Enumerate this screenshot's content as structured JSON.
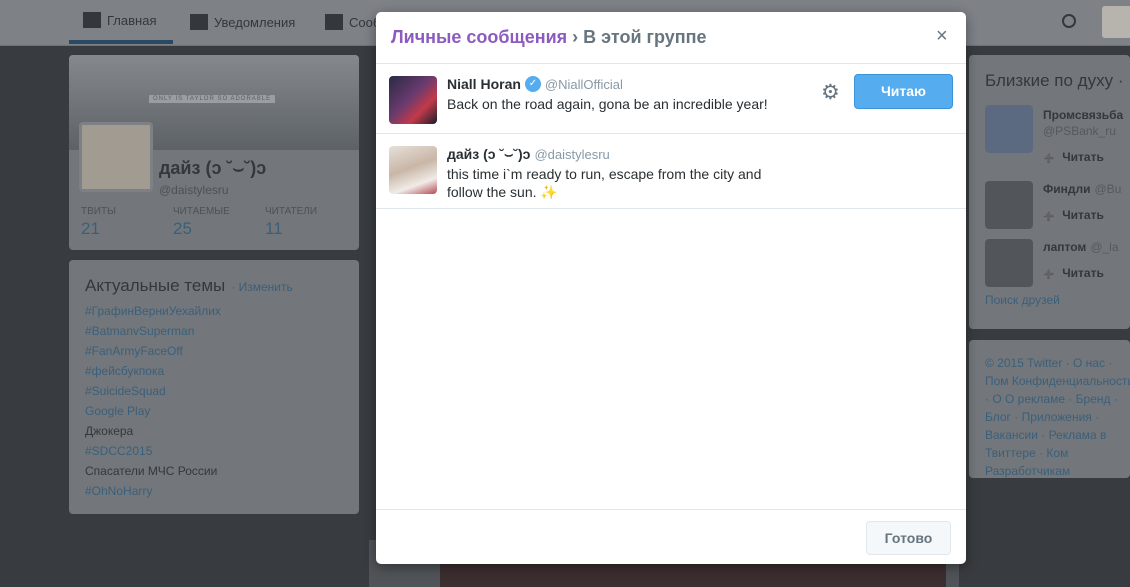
{
  "nav": {
    "home": "Главная",
    "notifications": "Уведомления",
    "messages": "Сооб"
  },
  "profile": {
    "banner_text": "ONLY IS TAYLOR SO ADORABLE",
    "name": "дайз (ɔ ˘⌣˘)ɔ",
    "handle": "@daistylesru",
    "stats": [
      {
        "label": "ТВИТЫ",
        "value": "21"
      },
      {
        "label": "ЧИТАЕМЫЕ",
        "value": "25"
      },
      {
        "label": "ЧИТАТЕЛИ",
        "value": "11"
      }
    ]
  },
  "trends": {
    "title": "Актуальные темы",
    "change": "· Изменить",
    "items": [
      {
        "text": "#ГрафинВерниУехайлих",
        "hashtag": true
      },
      {
        "text": "#BatmanvSuperman",
        "hashtag": true
      },
      {
        "text": "#FanArmyFaceOff",
        "hashtag": true
      },
      {
        "text": "#фейсбукпока",
        "hashtag": true
      },
      {
        "text": "#SuicideSquad",
        "hashtag": true
      },
      {
        "text": "Google Play",
        "hashtag": true
      },
      {
        "text": "Джокера",
        "hashtag": false
      },
      {
        "text": "#SDCC2015",
        "hashtag": true
      },
      {
        "text": "Спасатели МЧС России",
        "hashtag": false
      },
      {
        "text": "#OhNoHarry",
        "hashtag": true
      }
    ]
  },
  "recommendations": {
    "title": "Близкие по духу ·",
    "users": [
      {
        "name": "Промсвязьба",
        "handle": "@PSBank_ru",
        "button": "Читать"
      },
      {
        "name": "Финдли",
        "handle": "@Bu",
        "button": "Читать"
      },
      {
        "name": "лаптом",
        "handle": "@_la",
        "button": "Читать"
      }
    ],
    "friends_link": "Поиск друзей"
  },
  "footer": {
    "text": "© 2015 Twitter · О нас · Пом Конфиденциальность · О О рекламе · Бренд · Блог · Приложения · Вакансии · Реклама в Твиттере · Ком Разработчикам"
  },
  "modal": {
    "title_link": "Личные сообщения",
    "title_rest": " › В этой группе",
    "close": "×",
    "members": [
      {
        "name": "Niall Horan",
        "handle": "@NiallOfficial",
        "verified": true,
        "bio": "Back on the road again, gona be an incredible year!",
        "follow_label": "Читаю"
      },
      {
        "name": "дайз (ɔ ˘⌣˘)ɔ",
        "handle": "@daistylesru",
        "verified": false,
        "bio": "this time i`m ready to run, escape from the city and follow the sun. ✨"
      }
    ],
    "done_label": "Готово"
  },
  "colors": {
    "accent": "#55acee",
    "link_purple": "#8c5bbf",
    "text_secondary": "#66757f"
  }
}
